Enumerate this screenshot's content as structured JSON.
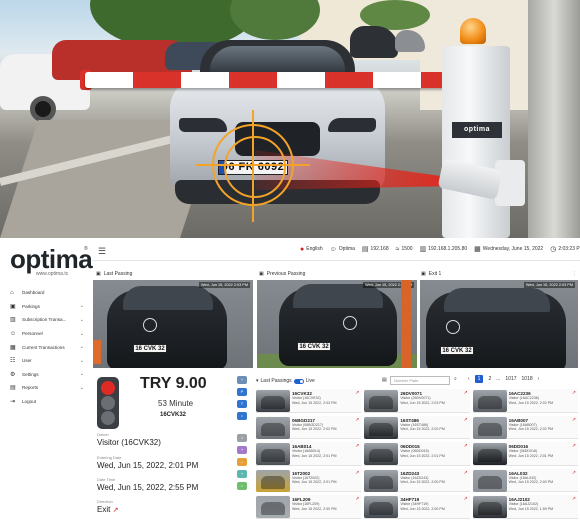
{
  "hero": {
    "plate_text": "06 FK 6092",
    "gate_brand": "optima"
  },
  "header": {
    "logo": "optima",
    "logo_reg": "®",
    "logo_sub": "www.optima.tc",
    "menu_icon": "hamburger-icon",
    "topbar": [
      {
        "icon": "red-dot-icon",
        "text": "English"
      },
      {
        "icon": "user-icon",
        "text": "Optima"
      },
      {
        "icon": "server-icon",
        "text": "192.168"
      },
      {
        "icon": "signal-icon",
        "text": "1500"
      },
      {
        "icon": "printer-icon",
        "text": "192.168.1.205.80"
      },
      {
        "icon": "calendar-icon",
        "text": "Wednesday, June 15, 2022"
      },
      {
        "icon": "clock-icon",
        "text": "2:03:23 PM"
      }
    ]
  },
  "sidebar": {
    "items": [
      {
        "icon": "home-icon",
        "label": "Dashboard",
        "chevron": false
      },
      {
        "icon": "parking-icon",
        "label": "Parkings",
        "chevron": true
      },
      {
        "icon": "subscription-icon",
        "label": "Subscription Transa...",
        "chevron": true
      },
      {
        "icon": "person-icon",
        "label": "Personnel",
        "chevron": true
      },
      {
        "icon": "panel-icon",
        "label": "Current Transactions",
        "chevron": true
      },
      {
        "icon": "users-icon",
        "label": "User",
        "chevron": true
      },
      {
        "icon": "settings-icon",
        "label": "Settings",
        "chevron": true
      },
      {
        "icon": "reports-icon",
        "label": "Reports",
        "chevron": true
      },
      {
        "icon": "logout-icon",
        "label": "Logout",
        "chevron": false
      }
    ]
  },
  "cameras": [
    {
      "title": "Last Passing",
      "timestamp": "Wed, Jun 15, 2022 2:03 PM",
      "plate": "16 CVK 32"
    },
    {
      "title": "Previous Passing",
      "timestamp": "Wed, Jun 15, 2022 2:01 PM",
      "plate": "16 CVK 32"
    },
    {
      "title": "Exit 1",
      "timestamp": "Wed, Jun 15, 2022 2:03 PM",
      "plate": "16 CVK 32"
    }
  ],
  "status": {
    "light": "red",
    "price": "TRY 9.00",
    "duration": "53 Minute",
    "plate": "16CVK32",
    "owner_label": "Owner",
    "owner": "Visitor (16CVK32)",
    "entry_label": "Entering Date",
    "entry": "Wed, Jun 15, 2022, 2:01 PM",
    "exit_label": "Date Time",
    "exit": "Wed, Jun 15, 2022, 2:55 PM",
    "direction_label": "Direction",
    "direction": "Exit",
    "direction_icon": "arrow-up-right-icon"
  },
  "quick_buttons": [
    {
      "label": "+",
      "color": "#6b8fb4"
    },
    {
      "label": "P",
      "color": "#2f74d0"
    },
    {
      "label": "T",
      "color": "#2f74d0"
    },
    {
      "label": "•",
      "color": "#2f74d0"
    },
    {
      "label": "=",
      "color": "#9aa0a6"
    },
    {
      "label": "+",
      "color": "#a579c9"
    },
    {
      "label": "–",
      "color": "#e6a03a"
    },
    {
      "label": "+",
      "color": "#5bb8b0"
    },
    {
      "label": "•",
      "color": "#6dbf6a"
    }
  ],
  "passings": {
    "title": "Last Passings",
    "toggle_label": "Live",
    "search_placeholder": "Number Plate",
    "pager": {
      "prev": "‹",
      "current": "1",
      "next": "2",
      "ellipsis": "...",
      "last_a": "1017",
      "last_b": "1018",
      "next_arrow": "›"
    },
    "items": [
      {
        "plate": "16CVK32",
        "owner": "Visitor (16CVK32)",
        "date": "Wed, Jun 15 2022, 2:03 PM",
        "color": "#3a3f45"
      },
      {
        "plate": "26DV0071",
        "owner": "Visitor (26DV0071)",
        "date": "Wed, Jun 15 2022, 2:03 PM",
        "color": "#4d5257"
      },
      {
        "plate": "16AC2236",
        "owner": "Visitor (16AC2236)",
        "date": "Wed, Jun 15 2022, 2:02 PM",
        "color": "#5a5f66"
      },
      {
        "plate": "06BGD217",
        "owner": "Visitor (06BGD217)",
        "date": "Wed, Jun 15 2022, 2:02 PM",
        "color": "#6e7379"
      },
      {
        "plate": "16ST486",
        "owner": "Visitor (16ST486)",
        "date": "Wed, Jun 15 2022, 2:02 PM",
        "color": "#2b2f34"
      },
      {
        "plate": "16AB007",
        "owner": "Visitor (16AB007)",
        "date": "Wed, Jun 15 2022, 2:02 PM",
        "color": "#80858b"
      },
      {
        "plate": "16AB014",
        "owner": "Visitor (16AB014)",
        "date": "Wed, Jun 15 2022, 2:01 PM",
        "color": "#4b5056"
      },
      {
        "plate": "06DD015",
        "owner": "Visitor (06DD015)",
        "date": "Wed, Jun 15 2022, 2:01 PM",
        "color": "#3c4045"
      },
      {
        "plate": "06DD016",
        "owner": "Visitor (06DD016)",
        "date": "Wed, Jun 15 2022, 2:01 PM",
        "color": "#1d2024"
      },
      {
        "plate": "16T2002",
        "owner": "Visitor (16T2002)",
        "date": "Wed, Jun 15 2022, 2:01 PM",
        "color": "#c9a233"
      },
      {
        "plate": "16ZD243",
        "owner": "Visitor (16ZD243)",
        "date": "Wed, Jun 15 2022, 2:00 PM",
        "color": "#5f646a"
      },
      {
        "plate": "16AL032",
        "owner": "Visitor (16AL032)",
        "date": "Wed, Jun 15 2022, 2:00 PM",
        "color": "#8d9298"
      },
      {
        "plate": "16FL209",
        "owner": "Visitor (16FL209)",
        "date": "Wed, Jun 15 2022, 2:00 PM",
        "color": "#a7acb1"
      },
      {
        "plate": "34HF719",
        "owner": "Visitor (34HF719)",
        "date": "Wed, Jun 15 2022, 2:00 PM",
        "color": "#454a50"
      },
      {
        "plate": "16AJ2102",
        "owner": "Visitor (16AJ2102)",
        "date": "Wed, Jun 15 2022, 1:59 PM",
        "color": "#2c3035"
      }
    ]
  }
}
